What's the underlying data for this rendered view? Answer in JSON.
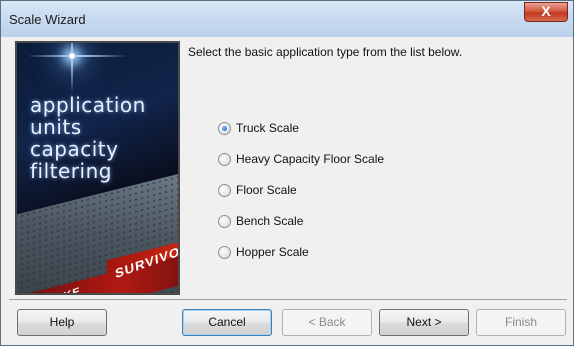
{
  "window": {
    "title": "Scale Wizard",
    "close_glyph": "X"
  },
  "image_panel": {
    "words": [
      "application",
      "units",
      "capacity",
      "filtering"
    ],
    "brand_primary": "SURVIVOR",
    "brand_secondary": "LAKE"
  },
  "content": {
    "prompt": "Select the basic application type from the list below.",
    "options": [
      {
        "label": "Truck Scale",
        "selected": true
      },
      {
        "label": "Heavy Capacity Floor Scale",
        "selected": false
      },
      {
        "label": "Floor Scale",
        "selected": false
      },
      {
        "label": "Bench Scale",
        "selected": false
      },
      {
        "label": "Hopper Scale",
        "selected": false
      }
    ]
  },
  "buttons": {
    "help": "Help",
    "cancel": "Cancel",
    "back": "< Back",
    "next": "Next >",
    "finish": "Finish"
  },
  "colors": {
    "titlebar": "#c8daef",
    "close": "#c3381f",
    "radio_selected": "#1a5fb4",
    "default_button_border": "#3c7fb1"
  }
}
